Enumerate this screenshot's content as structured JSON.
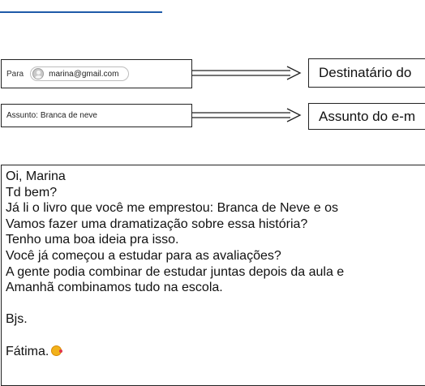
{
  "header": {
    "to_label": "Para",
    "to_recipient": "marina@gmail.com",
    "subject_label": "Assunto:",
    "subject_value": "Branca de neve"
  },
  "annotations": {
    "recipient": "Destinatário do",
    "subject": "Assunto do e-m"
  },
  "message": {
    "lines": [
      "Oi, Marina",
      "Td bem?",
      "Já li o livro que você me emprestou: Branca de Neve e os",
      "Vamos fazer uma dramatização sobre essa história?",
      "Tenho uma boa ideia pra isso.",
      "Você já começou a estudar para as avaliações?",
      "A gente podia combinar de estudar juntas depois da aula e",
      "Amanhã combinamos tudo na escola."
    ],
    "closing": "Bjs.",
    "signature": "Fátima.",
    "signature_icon": "smiley-icon"
  }
}
